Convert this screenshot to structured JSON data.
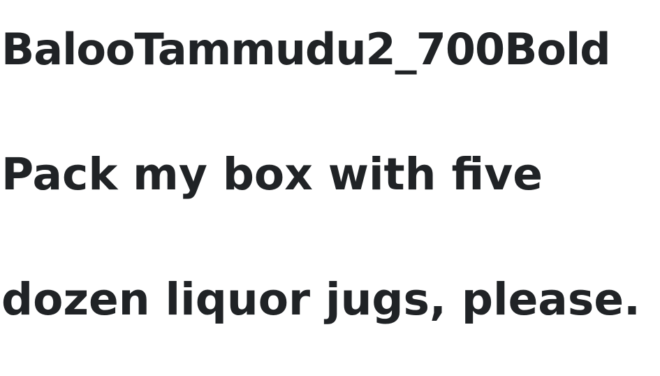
{
  "font_name": "BalooTammudu2_700Bold",
  "sample_lines": [
    "Pack my box with five",
    "dozen liquor jugs, please."
  ],
  "text_color": "#202326",
  "background_color": "#ffffff"
}
